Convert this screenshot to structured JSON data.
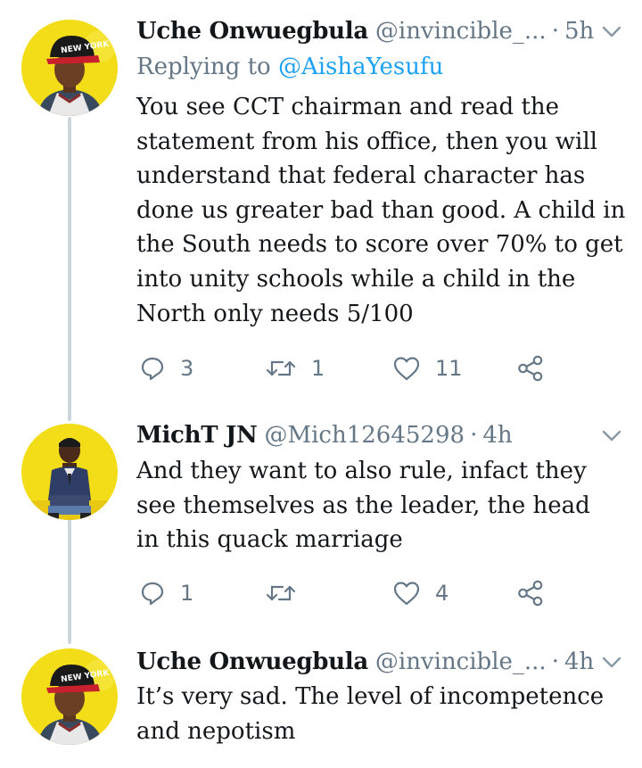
{
  "tweets": [
    {
      "name": "Uche Onwuegbula",
      "handle": "@invincible_...",
      "separator": "·",
      "time": "5h",
      "replying_prefix": "Replying to",
      "replying_to": "@AishaYesufu",
      "body_lines": [
        "You see CCT chairman and read the",
        "statement from his office, then you will",
        "understand that federal character has",
        "done us greater bad than good. A child in",
        "the South needs to score over 70% to get",
        "into unity schools while a child in the",
        "North only needs 5/100"
      ],
      "replies": "3",
      "retweets": "1",
      "likes": "11",
      "avatar": "ny-cap-avatar"
    },
    {
      "name": "MichT JN",
      "handle": "@Mich12645298",
      "separator": "·",
      "time": "4h",
      "body_lines": [
        "And they want to also rule, infact they",
        "see themselves as the leader, the head",
        "in this quack marriage"
      ],
      "replies": "1",
      "retweets": "",
      "likes": "4",
      "avatar": "seated-man-avatar"
    },
    {
      "name": "Uche Onwuegbula",
      "handle": "@invincible_...",
      "separator": "·",
      "time": "4h",
      "body_lines": [
        "It’s very sad. The level of incompetence",
        "and nepotism"
      ],
      "avatar": "ny-cap-avatar"
    }
  ],
  "colors": {
    "text": "#14171a",
    "secondary": "#657786",
    "link": "#1da1f2",
    "thread_line": "#ccd6dd",
    "avatar_bg": "#f2dd18"
  },
  "icons": [
    "reply-icon",
    "retweet-icon",
    "like-icon",
    "share-icon",
    "chevron-down-icon"
  ]
}
